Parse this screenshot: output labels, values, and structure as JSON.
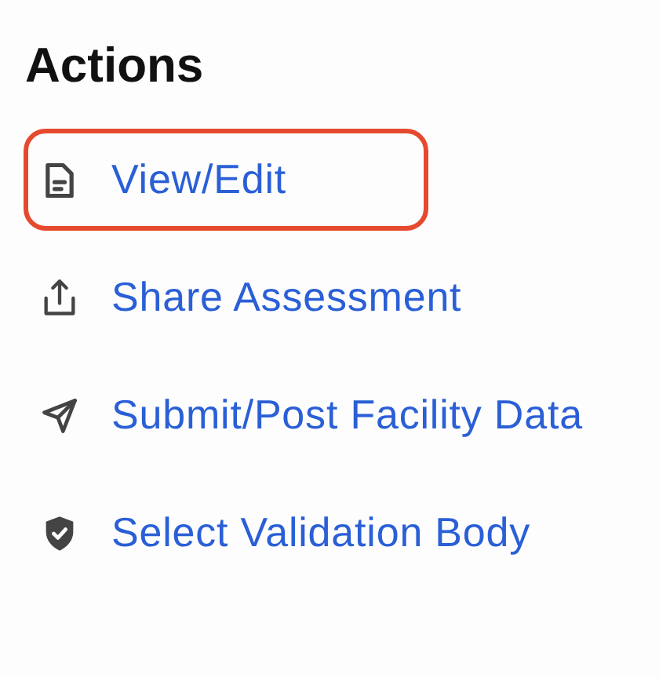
{
  "title": "Actions",
  "actions": [
    {
      "kind": "document",
      "label": "View/Edit",
      "selected": true
    },
    {
      "kind": "share",
      "label": "Share Assessment",
      "selected": false
    },
    {
      "kind": "send",
      "label": "Submit/Post Facility Data",
      "selected": false
    },
    {
      "kind": "shield",
      "label": "Select Validation Body",
      "selected": false
    }
  ]
}
